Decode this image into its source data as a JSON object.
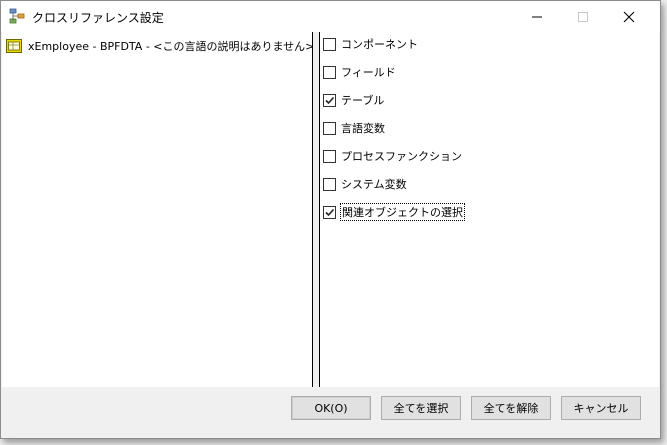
{
  "window": {
    "title": "クロスリファレンス設定"
  },
  "tree": {
    "item_label": "xEmployee - BPFDTA - <この言語の説明はありません>"
  },
  "options": [
    {
      "label": "コンポーネント",
      "checked": false
    },
    {
      "label": "フィールド",
      "checked": false
    },
    {
      "label": "テーブル",
      "checked": true
    },
    {
      "label": "言語変数",
      "checked": false
    },
    {
      "label": "プロセスファンクション",
      "checked": false
    },
    {
      "label": "システム変数",
      "checked": false
    },
    {
      "label": "関連オブジェクトの選択",
      "checked": true
    }
  ],
  "buttons": {
    "ok": "OK(O)",
    "select_all": "全てを選択",
    "deselect_all": "全てを解除",
    "cancel": "キャンセル"
  }
}
